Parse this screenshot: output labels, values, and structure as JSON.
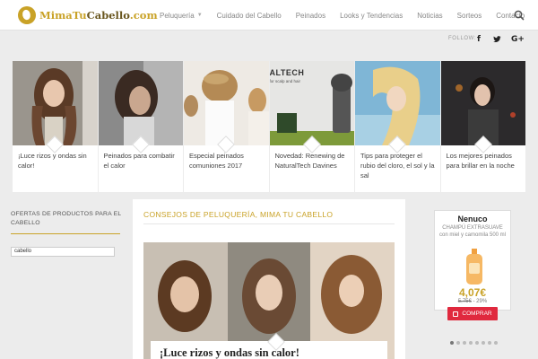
{
  "brand": {
    "logo_main": "MimaTu",
    "logo_dark": "Cabello",
    "logo_tld": ".com"
  },
  "nav": {
    "items": [
      {
        "label": "Peluquería",
        "has_dropdown": true
      },
      {
        "label": "Cuidado del Cabello"
      },
      {
        "label": "Peinados"
      },
      {
        "label": "Looks y Tendencias"
      },
      {
        "label": "Noticias"
      },
      {
        "label": "Sorteos"
      },
      {
        "label": "Contacto"
      }
    ],
    "search_icon": "search-icon"
  },
  "follow": {
    "label": "FOLLOW:",
    "networks": [
      "f",
      "t",
      "G+"
    ]
  },
  "slider": {
    "slides": [
      {
        "title": "¡Luce rizos y ondas sin calor!"
      },
      {
        "title": "Peinados para combatir el calor"
      },
      {
        "title": "Especial peinados comuniones 2017"
      },
      {
        "title": "Novedad: Renewing de NaturalTech Davines"
      },
      {
        "title": "Tips para proteger el rubio del cloro, el sol y la sal"
      },
      {
        "title": "Los mejores peinados para brillar en la noche"
      }
    ],
    "slide4_overlay": "ALTECH",
    "slide4_overlay_sub": "for scalp and hair"
  },
  "sidebar_left": {
    "title": "OFERTAS DE PRODUCTOS PARA EL CABELLO",
    "input_value": "cabello"
  },
  "main": {
    "heading": "CONSEJOS DE PELUQUERÍA, MIMA TU CABELLO",
    "feature_title": "¡Luce rizos y ondas sin calor!"
  },
  "product": {
    "name": "Nenuco",
    "description": "CHAMPÚ EXTRASUAVE con miel y camomila 500 ml",
    "price": "4,07€",
    "old_price": "5,75€",
    "discount": "- 29%",
    "button_label": "COMPRAR",
    "carousel_dots": 8,
    "active_dot": 0
  },
  "colors": {
    "accent": "#c9a227",
    "buy_button": "#e0293e"
  }
}
